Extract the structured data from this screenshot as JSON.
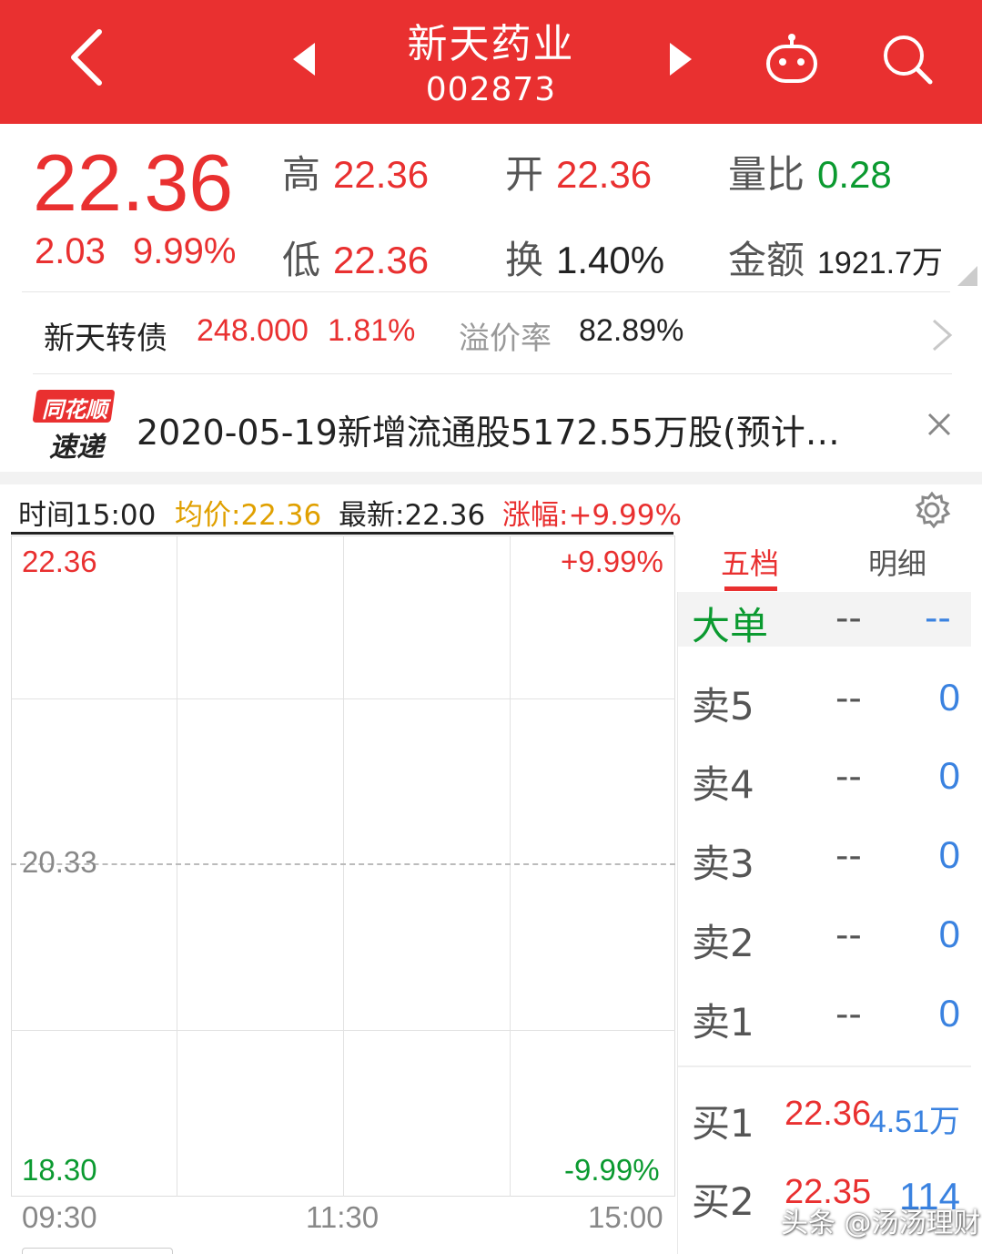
{
  "header": {
    "title": "新天药业",
    "code": "002873",
    "bg_color": "#e93030",
    "icons": [
      "back-arrow-icon",
      "prev-triangle-icon",
      "next-triangle-icon",
      "robot-icon",
      "search-icon"
    ]
  },
  "quote": {
    "price": "22.36",
    "change": "2.03",
    "change_pct": "9.99%",
    "high_label": "高",
    "high": "22.36",
    "open_label": "开",
    "open": "22.36",
    "vol_ratio_label": "量比",
    "vol_ratio": "0.28",
    "low_label": "低",
    "low": "22.36",
    "turnover_label": "换",
    "turnover": "1.40%",
    "amount_label": "金额",
    "amount": "1921.7万"
  },
  "bond": {
    "name": "新天转债",
    "price": "248.000",
    "pct": "1.81%",
    "premium_label": "溢价率",
    "premium": "82.89%"
  },
  "news": {
    "logo_line1": "同花顺",
    "logo_line2": "速递",
    "text": "2020-05-19新增流通股5172.55万股(预计…"
  },
  "infobar": {
    "time": "时间15:00",
    "avg": "均价:22.36",
    "latest": "最新:22.36",
    "rise": "涨幅:+9.99%"
  },
  "chart_data": {
    "type": "line",
    "title": "",
    "x_ticks": [
      "09:30",
      "11:30",
      "15:00"
    ],
    "y_left_ticks": [
      "22.36",
      "20.33",
      "18.30"
    ],
    "y_right_ticks": [
      "+9.99%",
      "-9.99%"
    ],
    "ylim": [
      18.3,
      22.36
    ],
    "prev_close": 20.33,
    "series": []
  },
  "orderbook": {
    "tabs": [
      "五档",
      "明细"
    ],
    "active_tab": "五档",
    "big_order": {
      "label": "大单",
      "col1": "--",
      "col2": "--"
    },
    "sells": [
      {
        "label": "卖5",
        "price": "--",
        "vol": "0"
      },
      {
        "label": "卖4",
        "price": "--",
        "vol": "0"
      },
      {
        "label": "卖3",
        "price": "--",
        "vol": "0"
      },
      {
        "label": "卖2",
        "price": "--",
        "vol": "0"
      },
      {
        "label": "卖1",
        "price": "--",
        "vol": "0"
      }
    ],
    "buys": [
      {
        "label": "买1",
        "price": "22.36",
        "vol": "4.51万"
      },
      {
        "label": "买2",
        "price": "22.35",
        "vol": "114"
      }
    ]
  },
  "watermark": "头条 @汤汤理财"
}
